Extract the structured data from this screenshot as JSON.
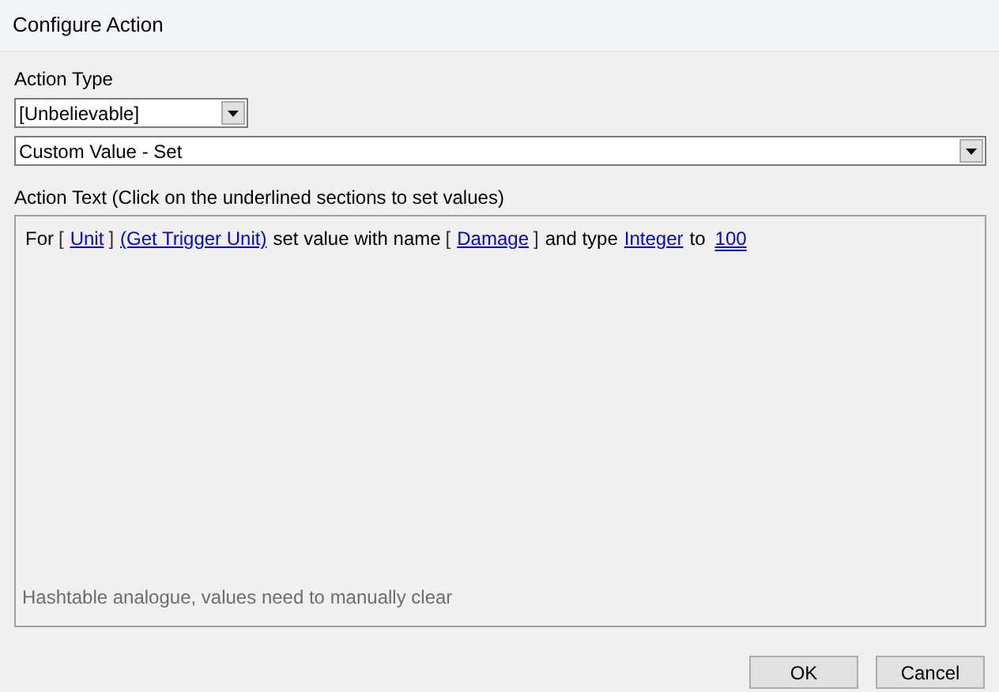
{
  "window": {
    "title": "Configure Action"
  },
  "action_type": {
    "label": "Action Type",
    "category": "[Unbelievable]",
    "action": "Custom Value - Set"
  },
  "action_text": {
    "label": "Action Text (Click on the underlined sections to set values)",
    "segments": [
      {
        "kind": "text",
        "text": "For"
      },
      {
        "kind": "bracket",
        "text": "["
      },
      {
        "kind": "link",
        "text": "Unit"
      },
      {
        "kind": "bracket",
        "text": "]"
      },
      {
        "kind": "link",
        "text": "(Get Trigger Unit)"
      },
      {
        "kind": "text",
        "text": "set value with name"
      },
      {
        "kind": "bracket",
        "text": "["
      },
      {
        "kind": "link",
        "text": "Damage"
      },
      {
        "kind": "bracket",
        "text": "]"
      },
      {
        "kind": "text",
        "text": "and type"
      },
      {
        "kind": "link",
        "text": "Integer"
      },
      {
        "kind": "text",
        "text": "to"
      },
      {
        "kind": "value",
        "text": "100"
      }
    ],
    "hint": "Hashtable analogue, values need to manually clear"
  },
  "buttons": [
    "OK",
    "Cancel"
  ]
}
